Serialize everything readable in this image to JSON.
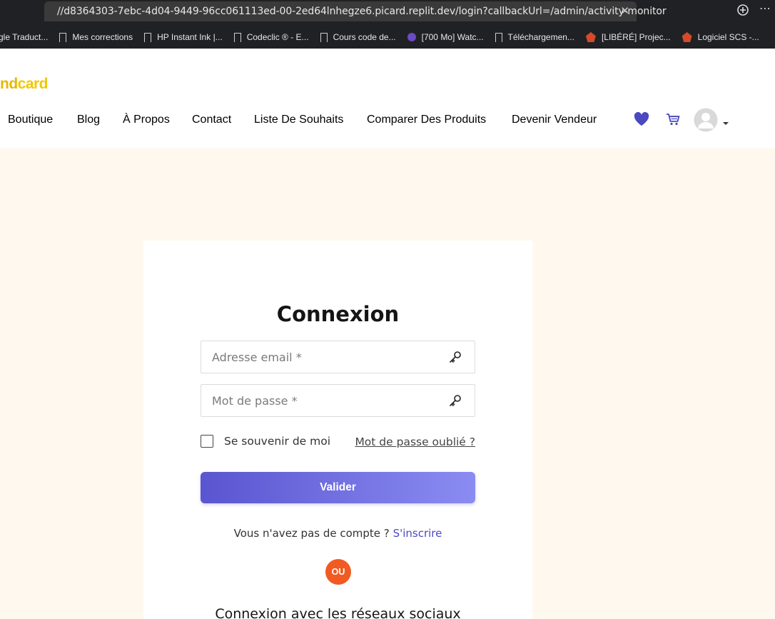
{
  "browser": {
    "url": "//d8364303-7ebc-4d04-9449-96cc061113ed-00-2ed64lnhegze6.picard.replit.dev/login?callbackUrl=/admin/activity-monitor",
    "bookmarks": [
      {
        "label": "gle Traduct...",
        "icon": "bookmark-icon"
      },
      {
        "label": "Mes corrections",
        "icon": "bookmark-icon"
      },
      {
        "label": "HP Instant Ink |...",
        "icon": "bookmark-icon"
      },
      {
        "label": "Codeclic ® - E...",
        "icon": "bookmark-icon"
      },
      {
        "label": "Cours code de...",
        "icon": "bookmark-icon"
      },
      {
        "label": "[700 Mo] Watc...",
        "icon": "site-favicon"
      },
      {
        "label": "Téléchargemen...",
        "icon": "bookmark-icon"
      },
      {
        "label": "[LIBÉRÉ] Projec...",
        "icon": "site-favicon"
      },
      {
        "label": "Logiciel SCS -...",
        "icon": "site-favicon"
      }
    ]
  },
  "header": {
    "logo_part1": "nd",
    "logo_part2": "card",
    "nav": [
      {
        "label": "Boutique"
      },
      {
        "label": "Blog"
      },
      {
        "label": "À Propos"
      },
      {
        "label": "Contact"
      },
      {
        "label": "Liste De Souhaits"
      },
      {
        "label": "Comparer Des Produits"
      },
      {
        "label": "Devenir Vendeur"
      }
    ],
    "accent_color": "#4b49c0"
  },
  "login": {
    "title": "Connexion",
    "email_placeholder": "Adresse email *",
    "email_value": "",
    "password_placeholder": "Mot de passe *",
    "password_value": "",
    "remember_label": "Se souvenir de moi",
    "remember_checked": false,
    "forgot_label": "Mot de passe oublié ?",
    "submit_label": "Valider",
    "no_account_text": "Vous n'avez pas de compte ?",
    "signup_label": "S'inscrire",
    "or_label": "OU",
    "social_title": "Connexion avec les réseaux sociaux"
  },
  "colors": {
    "page_background": "#fff8ef",
    "button_gradient_start": "#5a55d0",
    "button_gradient_end": "#8a8cf2",
    "or_badge": "#f15a22"
  }
}
